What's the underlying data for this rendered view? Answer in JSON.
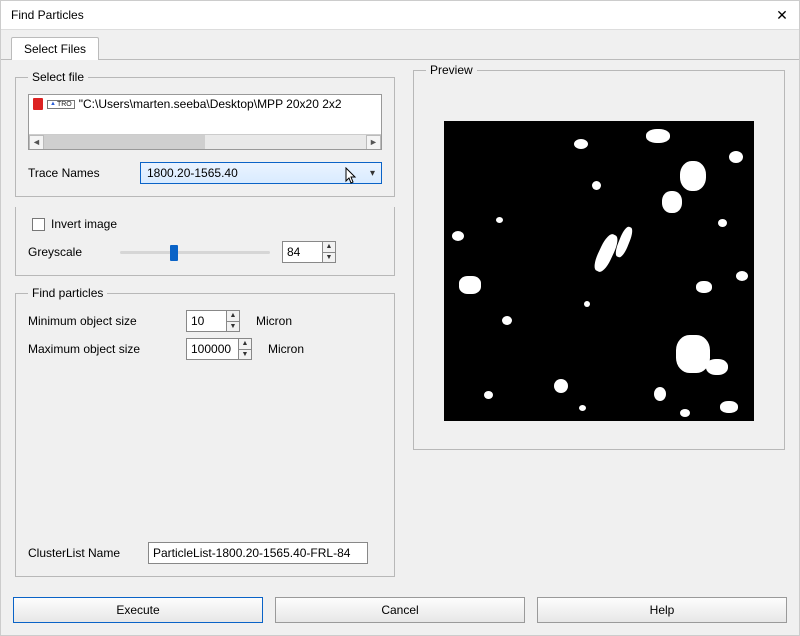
{
  "window": {
    "title": "Find Particles"
  },
  "tabs": {
    "select_files": "Select Files"
  },
  "select_file": {
    "legend": "Select file",
    "file_path": "\"C:\\Users\\marten.seeba\\Desktop\\MPP 20x20 2x2",
    "trace_label": "Trace Names",
    "trace_value": "1800.20-1565.40"
  },
  "greyscale": {
    "invert_label": "Invert image",
    "label": "Greyscale",
    "value": "84"
  },
  "find_particles": {
    "legend": "Find particles",
    "min_label": "Minimum object size",
    "min_value": "10",
    "max_label": "Maximum object size",
    "max_value": "100000",
    "unit": "Micron",
    "cluster_label": "ClusterList Name",
    "cluster_value": "ParticleList-1800.20-1565.40-FRL-84"
  },
  "preview": {
    "legend": "Preview"
  },
  "buttons": {
    "execute": "Execute",
    "cancel": "Cancel",
    "help": "Help"
  }
}
